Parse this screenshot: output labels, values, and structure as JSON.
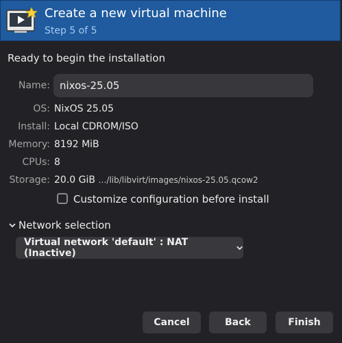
{
  "header": {
    "title": "Create a new virtual machine",
    "step": "Step 5 of 5",
    "icon": "monitor-star-icon"
  },
  "ready_text": "Ready to begin the installation",
  "summary": {
    "name_label": "Name:",
    "name_value": "nixos-25.05",
    "os_label": "OS:",
    "os_value": "NixOS 25.05",
    "install_label": "Install:",
    "install_value": "Local CDROM/ISO",
    "memory_label": "Memory:",
    "memory_value": "8192 MiB",
    "cpus_label": "CPUs:",
    "cpus_value": "8",
    "storage_label": "Storage:",
    "storage_size": "20.0 GiB",
    "storage_path": "…/lib/libvirt/images/nixos-25.05.qcow2"
  },
  "customize": {
    "label": "Customize configuration before install",
    "checked": false
  },
  "network": {
    "section_label": "Network selection",
    "selected": "Virtual network 'default' : NAT (Inactive)"
  },
  "buttons": {
    "cancel": "Cancel",
    "back": "Back",
    "finish": "Finish"
  },
  "colors": {
    "header_bg": "#1f5b9e",
    "window_bg": "#222226",
    "button_bg": "#38383d"
  }
}
